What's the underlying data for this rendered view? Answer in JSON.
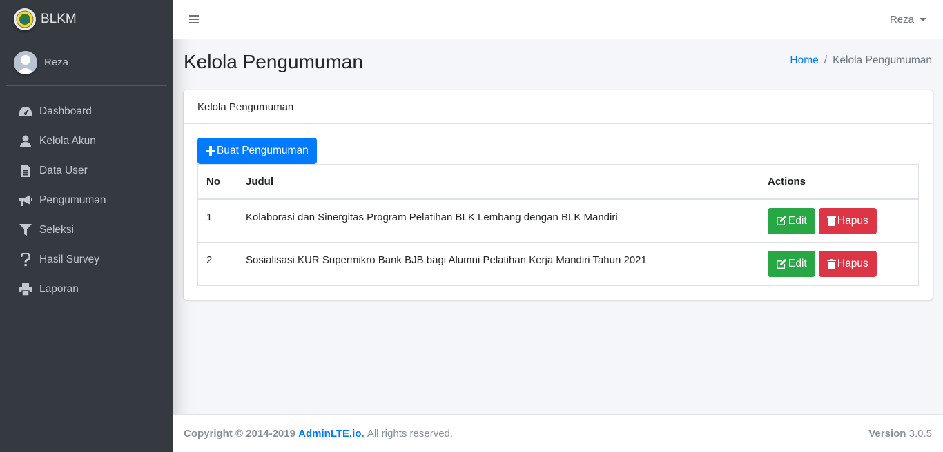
{
  "brand": {
    "name": "BLKM"
  },
  "sidebar": {
    "user": "Reza",
    "items": [
      {
        "label": "Dashboard",
        "icon": "tachometer-icon"
      },
      {
        "label": "Kelola Akun",
        "icon": "user-icon"
      },
      {
        "label": "Data User",
        "icon": "file-icon"
      },
      {
        "label": "Pengumuman",
        "icon": "bullhorn-icon"
      },
      {
        "label": "Seleksi",
        "icon": "filter-icon"
      },
      {
        "label": "Hasil Survey",
        "icon": "question-icon"
      },
      {
        "label": "Laporan",
        "icon": "print-icon"
      }
    ]
  },
  "topbar": {
    "user": "Reza"
  },
  "page": {
    "title": "Kelola Pengumuman",
    "breadcrumb": {
      "home": "Home",
      "separator": "/",
      "current": "Kelola Pengumuman"
    }
  },
  "card": {
    "header": "Kelola Pengumuman",
    "create_label": "Buat Pengumuman",
    "table": {
      "headers": [
        "No",
        "Judul",
        "Actions"
      ],
      "rows": [
        {
          "no": "1",
          "judul": "Kolaborasi dan Sinergitas Program Pelatihan BLK Lembang dengan BLK Mandiri"
        },
        {
          "no": "2",
          "judul": "Sosialisasi KUR Supermikro Bank BJB bagi Alumni Pelatihan Kerja Mandiri Tahun 2021"
        }
      ],
      "edit_label": "Edit",
      "delete_label": "Hapus"
    }
  },
  "footer": {
    "copyright": "Copyright © 2014-2019",
    "link": "AdminLTE.io.",
    "rights": "All rights reserved.",
    "version_label": "Version",
    "version": "3.0.5"
  },
  "colors": {
    "sidebar_bg": "#343a40",
    "primary": "#007bff",
    "success": "#28a745",
    "danger": "#dc3545"
  }
}
